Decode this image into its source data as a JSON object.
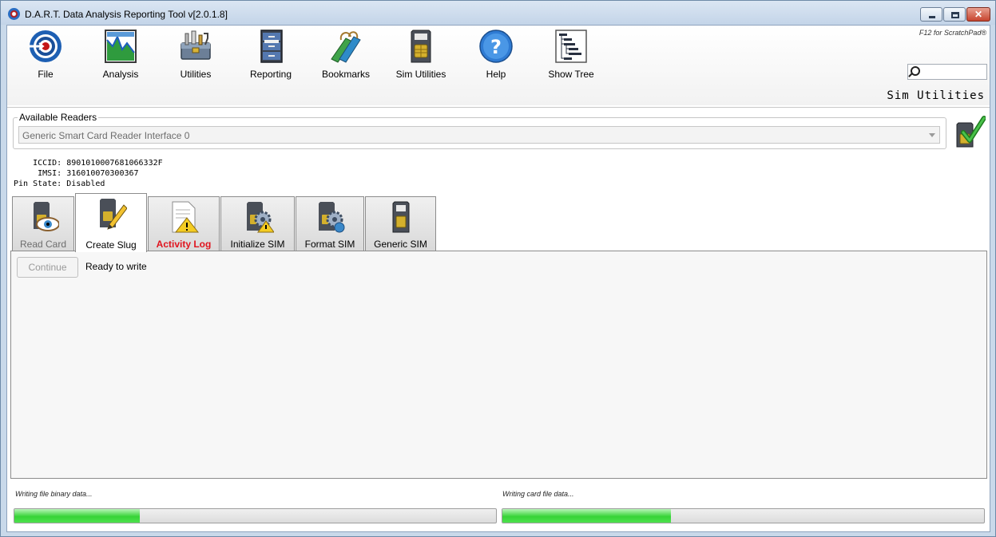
{
  "window": {
    "title": "D.A.R.T. Data Analysis Reporting Tool v[2.0.1.8]",
    "controls": [
      "minimize",
      "maximize",
      "close"
    ]
  },
  "toolbar": {
    "items": [
      {
        "label": "File",
        "icon": "file-target-icon"
      },
      {
        "label": "Analysis",
        "icon": "analysis-chart-icon"
      },
      {
        "label": "Utilities",
        "icon": "toolbox-icon"
      },
      {
        "label": "Reporting",
        "icon": "filing-cabinet-icon"
      },
      {
        "label": "Bookmarks",
        "icon": "bookmarks-icon"
      },
      {
        "label": "Sim Utilities",
        "icon": "sim-card-icon"
      },
      {
        "label": "Help",
        "icon": "help-icon"
      },
      {
        "label": "Show Tree",
        "icon": "tree-icon"
      }
    ],
    "scratchpad_hint": "F12 for ScratchPad®",
    "search": {
      "value": "",
      "placeholder": ""
    },
    "section_title": "Sim Utilities"
  },
  "readers": {
    "legend": "Available Readers",
    "selected": "Generic Smart Card Reader Interface 0"
  },
  "sim_info": {
    "text": "    ICCID: 8901010007681066332F\n     IMSI: 316010070300367\nPin State: Disabled"
  },
  "tabs": [
    {
      "label": "Read Card",
      "icon": "sim-eye-icon",
      "state": "disabled"
    },
    {
      "label": "Create Slug",
      "icon": "sim-pencil-icon",
      "state": "active"
    },
    {
      "label": "Activity Log",
      "icon": "log-warning-icon",
      "state": "alert"
    },
    {
      "label": "Initialize SIM",
      "icon": "sim-gear-warning-icon",
      "state": "normal"
    },
    {
      "label": "Format SIM",
      "icon": "sim-gear-icon",
      "state": "normal"
    },
    {
      "label": "Generic SIM",
      "icon": "generic-sim-icon",
      "state": "normal"
    }
  ],
  "panel": {
    "continue_label": "Continue",
    "status": "Ready to write"
  },
  "progress": [
    {
      "label": "Writing file binary data...",
      "value": 0.26
    },
    {
      "label": "Writing card file data...",
      "value": 0.35
    }
  ]
}
